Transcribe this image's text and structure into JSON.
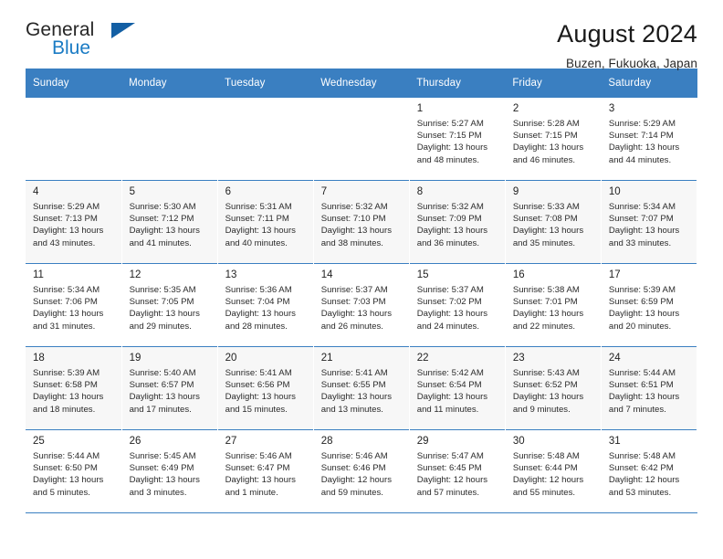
{
  "brand": {
    "name_top": "General",
    "name_bottom": "Blue",
    "accent_color": "#1a7bc4",
    "triangle_color": "#135fa4"
  },
  "header": {
    "title": "August 2024",
    "subtitle": "Buzen, Fukuoka, Japan"
  },
  "theme": {
    "header_row_bg": "#3a7fc1",
    "header_row_text": "#ffffff",
    "alt_row_bg": "#f7f7f7",
    "rule_color": "#3a7fc1"
  },
  "weekday_headers": [
    "Sunday",
    "Monday",
    "Tuesday",
    "Wednesday",
    "Thursday",
    "Friday",
    "Saturday"
  ],
  "weeks": [
    {
      "shaded": false,
      "days": [
        {
          "num": "",
          "detail": ""
        },
        {
          "num": "",
          "detail": ""
        },
        {
          "num": "",
          "detail": ""
        },
        {
          "num": "",
          "detail": ""
        },
        {
          "num": "1",
          "detail": "Sunrise: 5:27 AM\nSunset: 7:15 PM\nDaylight: 13 hours\nand 48 minutes."
        },
        {
          "num": "2",
          "detail": "Sunrise: 5:28 AM\nSunset: 7:15 PM\nDaylight: 13 hours\nand 46 minutes."
        },
        {
          "num": "3",
          "detail": "Sunrise: 5:29 AM\nSunset: 7:14 PM\nDaylight: 13 hours\nand 44 minutes."
        }
      ]
    },
    {
      "shaded": true,
      "days": [
        {
          "num": "4",
          "detail": "Sunrise: 5:29 AM\nSunset: 7:13 PM\nDaylight: 13 hours\nand 43 minutes."
        },
        {
          "num": "5",
          "detail": "Sunrise: 5:30 AM\nSunset: 7:12 PM\nDaylight: 13 hours\nand 41 minutes."
        },
        {
          "num": "6",
          "detail": "Sunrise: 5:31 AM\nSunset: 7:11 PM\nDaylight: 13 hours\nand 40 minutes."
        },
        {
          "num": "7",
          "detail": "Sunrise: 5:32 AM\nSunset: 7:10 PM\nDaylight: 13 hours\nand 38 minutes."
        },
        {
          "num": "8",
          "detail": "Sunrise: 5:32 AM\nSunset: 7:09 PM\nDaylight: 13 hours\nand 36 minutes."
        },
        {
          "num": "9",
          "detail": "Sunrise: 5:33 AM\nSunset: 7:08 PM\nDaylight: 13 hours\nand 35 minutes."
        },
        {
          "num": "10",
          "detail": "Sunrise: 5:34 AM\nSunset: 7:07 PM\nDaylight: 13 hours\nand 33 minutes."
        }
      ]
    },
    {
      "shaded": false,
      "days": [
        {
          "num": "11",
          "detail": "Sunrise: 5:34 AM\nSunset: 7:06 PM\nDaylight: 13 hours\nand 31 minutes."
        },
        {
          "num": "12",
          "detail": "Sunrise: 5:35 AM\nSunset: 7:05 PM\nDaylight: 13 hours\nand 29 minutes."
        },
        {
          "num": "13",
          "detail": "Sunrise: 5:36 AM\nSunset: 7:04 PM\nDaylight: 13 hours\nand 28 minutes."
        },
        {
          "num": "14",
          "detail": "Sunrise: 5:37 AM\nSunset: 7:03 PM\nDaylight: 13 hours\nand 26 minutes."
        },
        {
          "num": "15",
          "detail": "Sunrise: 5:37 AM\nSunset: 7:02 PM\nDaylight: 13 hours\nand 24 minutes."
        },
        {
          "num": "16",
          "detail": "Sunrise: 5:38 AM\nSunset: 7:01 PM\nDaylight: 13 hours\nand 22 minutes."
        },
        {
          "num": "17",
          "detail": "Sunrise: 5:39 AM\nSunset: 6:59 PM\nDaylight: 13 hours\nand 20 minutes."
        }
      ]
    },
    {
      "shaded": true,
      "days": [
        {
          "num": "18",
          "detail": "Sunrise: 5:39 AM\nSunset: 6:58 PM\nDaylight: 13 hours\nand 18 minutes."
        },
        {
          "num": "19",
          "detail": "Sunrise: 5:40 AM\nSunset: 6:57 PM\nDaylight: 13 hours\nand 17 minutes."
        },
        {
          "num": "20",
          "detail": "Sunrise: 5:41 AM\nSunset: 6:56 PM\nDaylight: 13 hours\nand 15 minutes."
        },
        {
          "num": "21",
          "detail": "Sunrise: 5:41 AM\nSunset: 6:55 PM\nDaylight: 13 hours\nand 13 minutes."
        },
        {
          "num": "22",
          "detail": "Sunrise: 5:42 AM\nSunset: 6:54 PM\nDaylight: 13 hours\nand 11 minutes."
        },
        {
          "num": "23",
          "detail": "Sunrise: 5:43 AM\nSunset: 6:52 PM\nDaylight: 13 hours\nand 9 minutes."
        },
        {
          "num": "24",
          "detail": "Sunrise: 5:44 AM\nSunset: 6:51 PM\nDaylight: 13 hours\nand 7 minutes."
        }
      ]
    },
    {
      "shaded": false,
      "days": [
        {
          "num": "25",
          "detail": "Sunrise: 5:44 AM\nSunset: 6:50 PM\nDaylight: 13 hours\nand 5 minutes."
        },
        {
          "num": "26",
          "detail": "Sunrise: 5:45 AM\nSunset: 6:49 PM\nDaylight: 13 hours\nand 3 minutes."
        },
        {
          "num": "27",
          "detail": "Sunrise: 5:46 AM\nSunset: 6:47 PM\nDaylight: 13 hours\nand 1 minute."
        },
        {
          "num": "28",
          "detail": "Sunrise: 5:46 AM\nSunset: 6:46 PM\nDaylight: 12 hours\nand 59 minutes."
        },
        {
          "num": "29",
          "detail": "Sunrise: 5:47 AM\nSunset: 6:45 PM\nDaylight: 12 hours\nand 57 minutes."
        },
        {
          "num": "30",
          "detail": "Sunrise: 5:48 AM\nSunset: 6:44 PM\nDaylight: 12 hours\nand 55 minutes."
        },
        {
          "num": "31",
          "detail": "Sunrise: 5:48 AM\nSunset: 6:42 PM\nDaylight: 12 hours\nand 53 minutes."
        }
      ]
    }
  ]
}
